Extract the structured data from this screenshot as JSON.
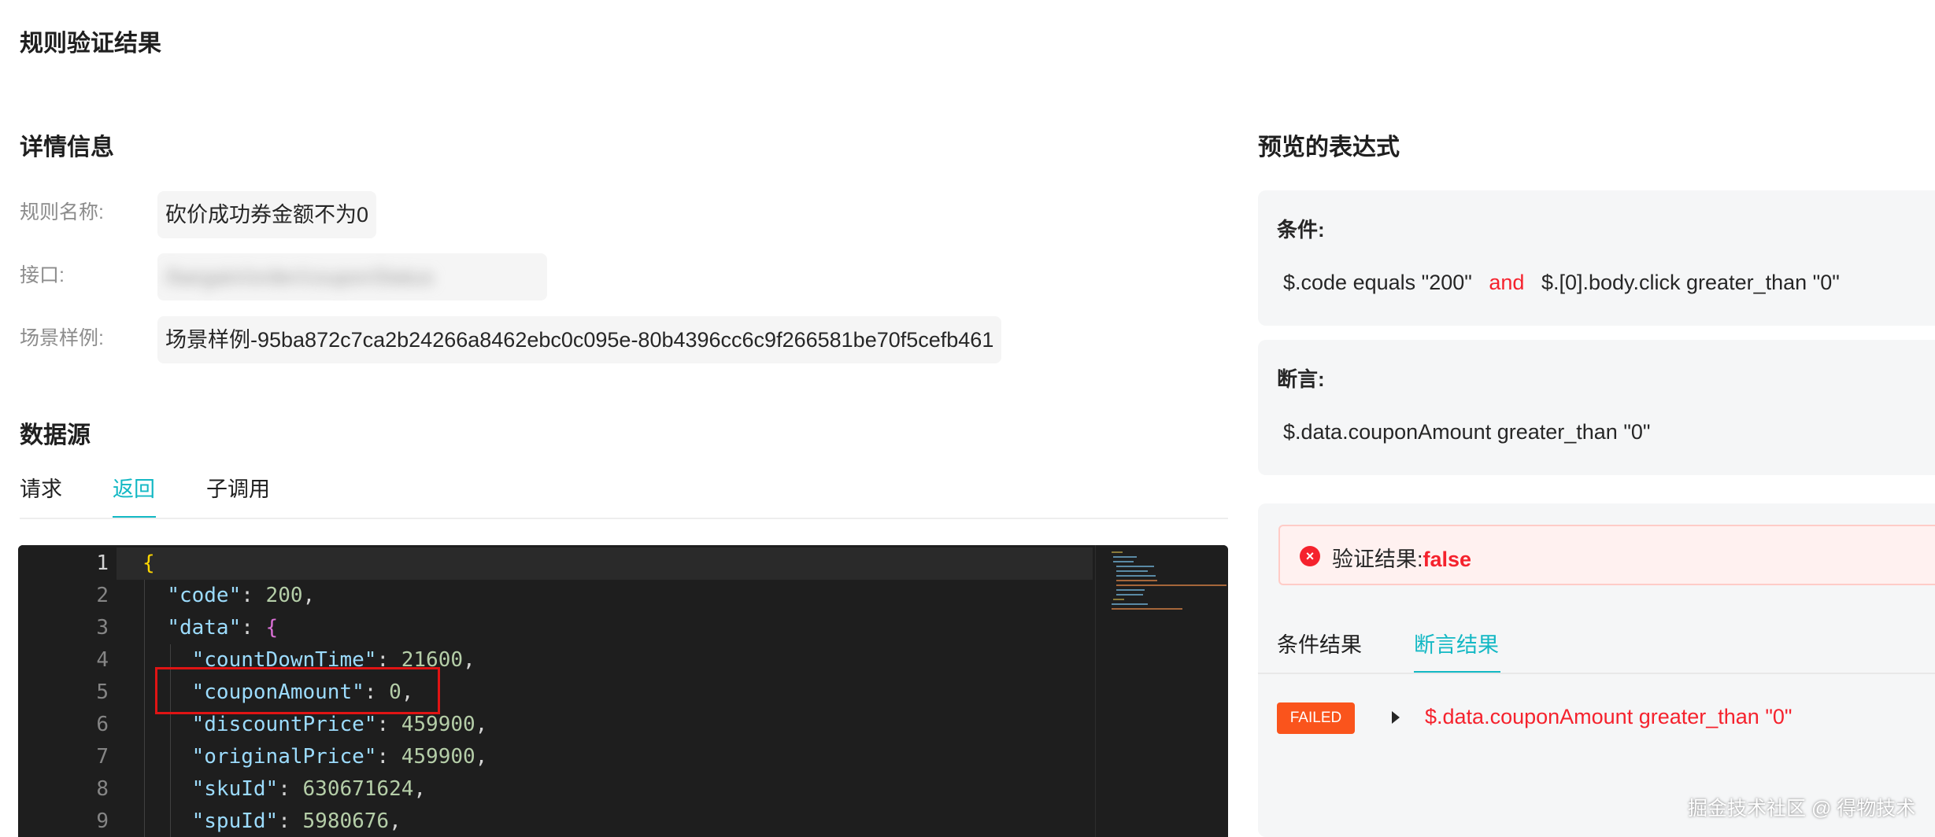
{
  "page": {
    "title": "规则验证结果"
  },
  "details": {
    "title": "详情信息",
    "fields": [
      {
        "label": "规则名称:",
        "value": "砍价成功券金额不为0"
      },
      {
        "label": "接口:",
        "value": "/bargain/order/couponStatus"
      },
      {
        "label": "场景样例:",
        "value": "场景样例-95ba872c7ca2b24266a8462ebc0c095e-80b4396cc6c9f266581be70f5cefb461"
      }
    ]
  },
  "datasource": {
    "title": "数据源",
    "tabs": [
      "请求",
      "返回",
      "子调用"
    ],
    "active_tab": "返回"
  },
  "editor": {
    "line_numbers": [
      "1",
      "2",
      "3",
      "4",
      "5",
      "6",
      "7",
      "8",
      "9"
    ],
    "lines": [
      {
        "tokens": [
          {
            "t": "{",
            "c": "tk-brace"
          }
        ]
      },
      {
        "tokens": [
          {
            "t": "  ",
            "c": ""
          },
          {
            "t": "\"code\"",
            "c": "tk-key"
          },
          {
            "t": ": ",
            "c": "tk-punc"
          },
          {
            "t": "200",
            "c": "tk-num"
          },
          {
            "t": ",",
            "c": "tk-punc"
          }
        ]
      },
      {
        "tokens": [
          {
            "t": "  ",
            "c": ""
          },
          {
            "t": "\"data\"",
            "c": "tk-key"
          },
          {
            "t": ": ",
            "c": "tk-punc"
          },
          {
            "t": "{",
            "c": "tk-brace2"
          }
        ]
      },
      {
        "tokens": [
          {
            "t": "    ",
            "c": ""
          },
          {
            "t": "\"countDownTime\"",
            "c": "tk-key"
          },
          {
            "t": ": ",
            "c": "tk-punc"
          },
          {
            "t": "21600",
            "c": "tk-num"
          },
          {
            "t": ",",
            "c": "tk-punc"
          }
        ]
      },
      {
        "tokens": [
          {
            "t": "    ",
            "c": ""
          },
          {
            "t": "\"couponAmount\"",
            "c": "tk-key"
          },
          {
            "t": ": ",
            "c": "tk-punc"
          },
          {
            "t": "0",
            "c": "tk-num"
          },
          {
            "t": ",",
            "c": "tk-punc"
          }
        ]
      },
      {
        "tokens": [
          {
            "t": "    ",
            "c": ""
          },
          {
            "t": "\"discountPrice\"",
            "c": "tk-key"
          },
          {
            "t": ": ",
            "c": "tk-punc"
          },
          {
            "t": "459900",
            "c": "tk-num"
          },
          {
            "t": ",",
            "c": "tk-punc"
          }
        ]
      },
      {
        "tokens": [
          {
            "t": "    ",
            "c": ""
          },
          {
            "t": "\"originalPrice\"",
            "c": "tk-key"
          },
          {
            "t": ": ",
            "c": "tk-punc"
          },
          {
            "t": "459900",
            "c": "tk-num"
          },
          {
            "t": ",",
            "c": "tk-punc"
          }
        ]
      },
      {
        "tokens": [
          {
            "t": "    ",
            "c": ""
          },
          {
            "t": "\"skuId\"",
            "c": "tk-key"
          },
          {
            "t": ": ",
            "c": "tk-punc"
          },
          {
            "t": "630671624",
            "c": "tk-num"
          },
          {
            "t": ",",
            "c": "tk-punc"
          }
        ]
      },
      {
        "tokens": [
          {
            "t": "    ",
            "c": ""
          },
          {
            "t": "\"spuId\"",
            "c": "tk-key"
          },
          {
            "t": ": ",
            "c": "tk-punc"
          },
          {
            "t": "5980676",
            "c": "tk-num"
          },
          {
            "t": ",",
            "c": "tk-punc"
          }
        ]
      }
    ]
  },
  "preview": {
    "title": "预览的表达式",
    "condition": {
      "label": "条件:",
      "left": "$.code equals \"200\"",
      "op": "and",
      "right": "$.[0].body.click greater_than \"0\""
    },
    "assertion": {
      "label": "断言:",
      "expr": "$.data.couponAmount greater_than \"0\""
    }
  },
  "result": {
    "label": "验证结果:",
    "value": "false",
    "tabs": [
      "条件结果",
      "断言结果"
    ],
    "active_tab": "断言结果",
    "items": [
      {
        "status": "FAILED",
        "expr": "$.data.couponAmount greater_than \"0\""
      }
    ]
  },
  "watermark": "掘金技术社区 @ 得物技术",
  "colors": {
    "accent": "#13b8c4",
    "error": "#f5222d",
    "failed_tag": "#fa541c",
    "editor_bg": "#1e1e1e"
  }
}
